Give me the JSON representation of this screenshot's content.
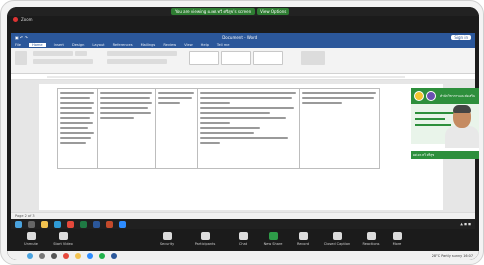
{
  "zoom": {
    "banner": "You are viewing ผ.ยศ.ทวี ศรีสุข's screen",
    "view_options": "View Options",
    "window_title": "Zoom"
  },
  "word": {
    "title": "Document - Word",
    "user_badge": "Sign in",
    "tabs": [
      "File",
      "Home",
      "Insert",
      "Design",
      "Layout",
      "References",
      "Mailings",
      "Review",
      "View",
      "Help",
      "Tell me"
    ],
    "status": "Page 2 of 3"
  },
  "video": {
    "name": "ผศ.ดร.ทวี ศรีสุข",
    "org_line": "สำนักวิชาการและส่งเสริม"
  },
  "toolbar": {
    "items": [
      {
        "label": "Unmute",
        "icon": "microphone-icon"
      },
      {
        "label": "Start Video",
        "icon": "video-camera-icon"
      },
      {
        "label": "Security",
        "icon": "shield-icon"
      },
      {
        "label": "Participants",
        "icon": "people-icon"
      },
      {
        "label": "Chat",
        "icon": "chat-icon"
      },
      {
        "label": "New Share",
        "icon": "share-screen-icon"
      },
      {
        "label": "Record",
        "icon": "record-icon"
      },
      {
        "label": "Closed Caption",
        "icon": "cc-icon"
      },
      {
        "label": "Reactions",
        "icon": "emoji-icon"
      },
      {
        "label": "More",
        "icon": "more-icon"
      }
    ]
  },
  "windows": {
    "tray": "28°C Partly sunny",
    "clock": "16:07"
  },
  "colors": {
    "word_blue": "#2b579a",
    "accent_green": "#2d8f3c"
  }
}
